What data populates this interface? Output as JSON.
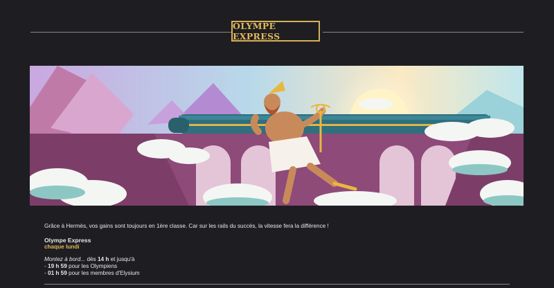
{
  "header": {
    "title": "OLYMPE EXPRESS"
  },
  "banner": {
    "alt": "Hermès courant devant un train sur un viaduc dans les nuages"
  },
  "content": {
    "intro": "Grâce à Hermès, vos gains sont toujours en 1ère classe. Car sur les rails du succès, la vitesse fera la différence !",
    "event_name": "Olympe Express",
    "event_day": "chaque lundi",
    "board_prefix": "Montez à bord...",
    "board_mid": " dès ",
    "board_time": "14 h",
    "board_suffix": " et jusqu'à",
    "items": [
      {
        "time": "19 h 59",
        "text": " pour les Olympiens"
      },
      {
        "time": "01 h 59",
        "text": " pour les membres d'Elysium"
      }
    ]
  },
  "colors": {
    "accent": "#e2b85a",
    "background": "#1e1e22"
  }
}
